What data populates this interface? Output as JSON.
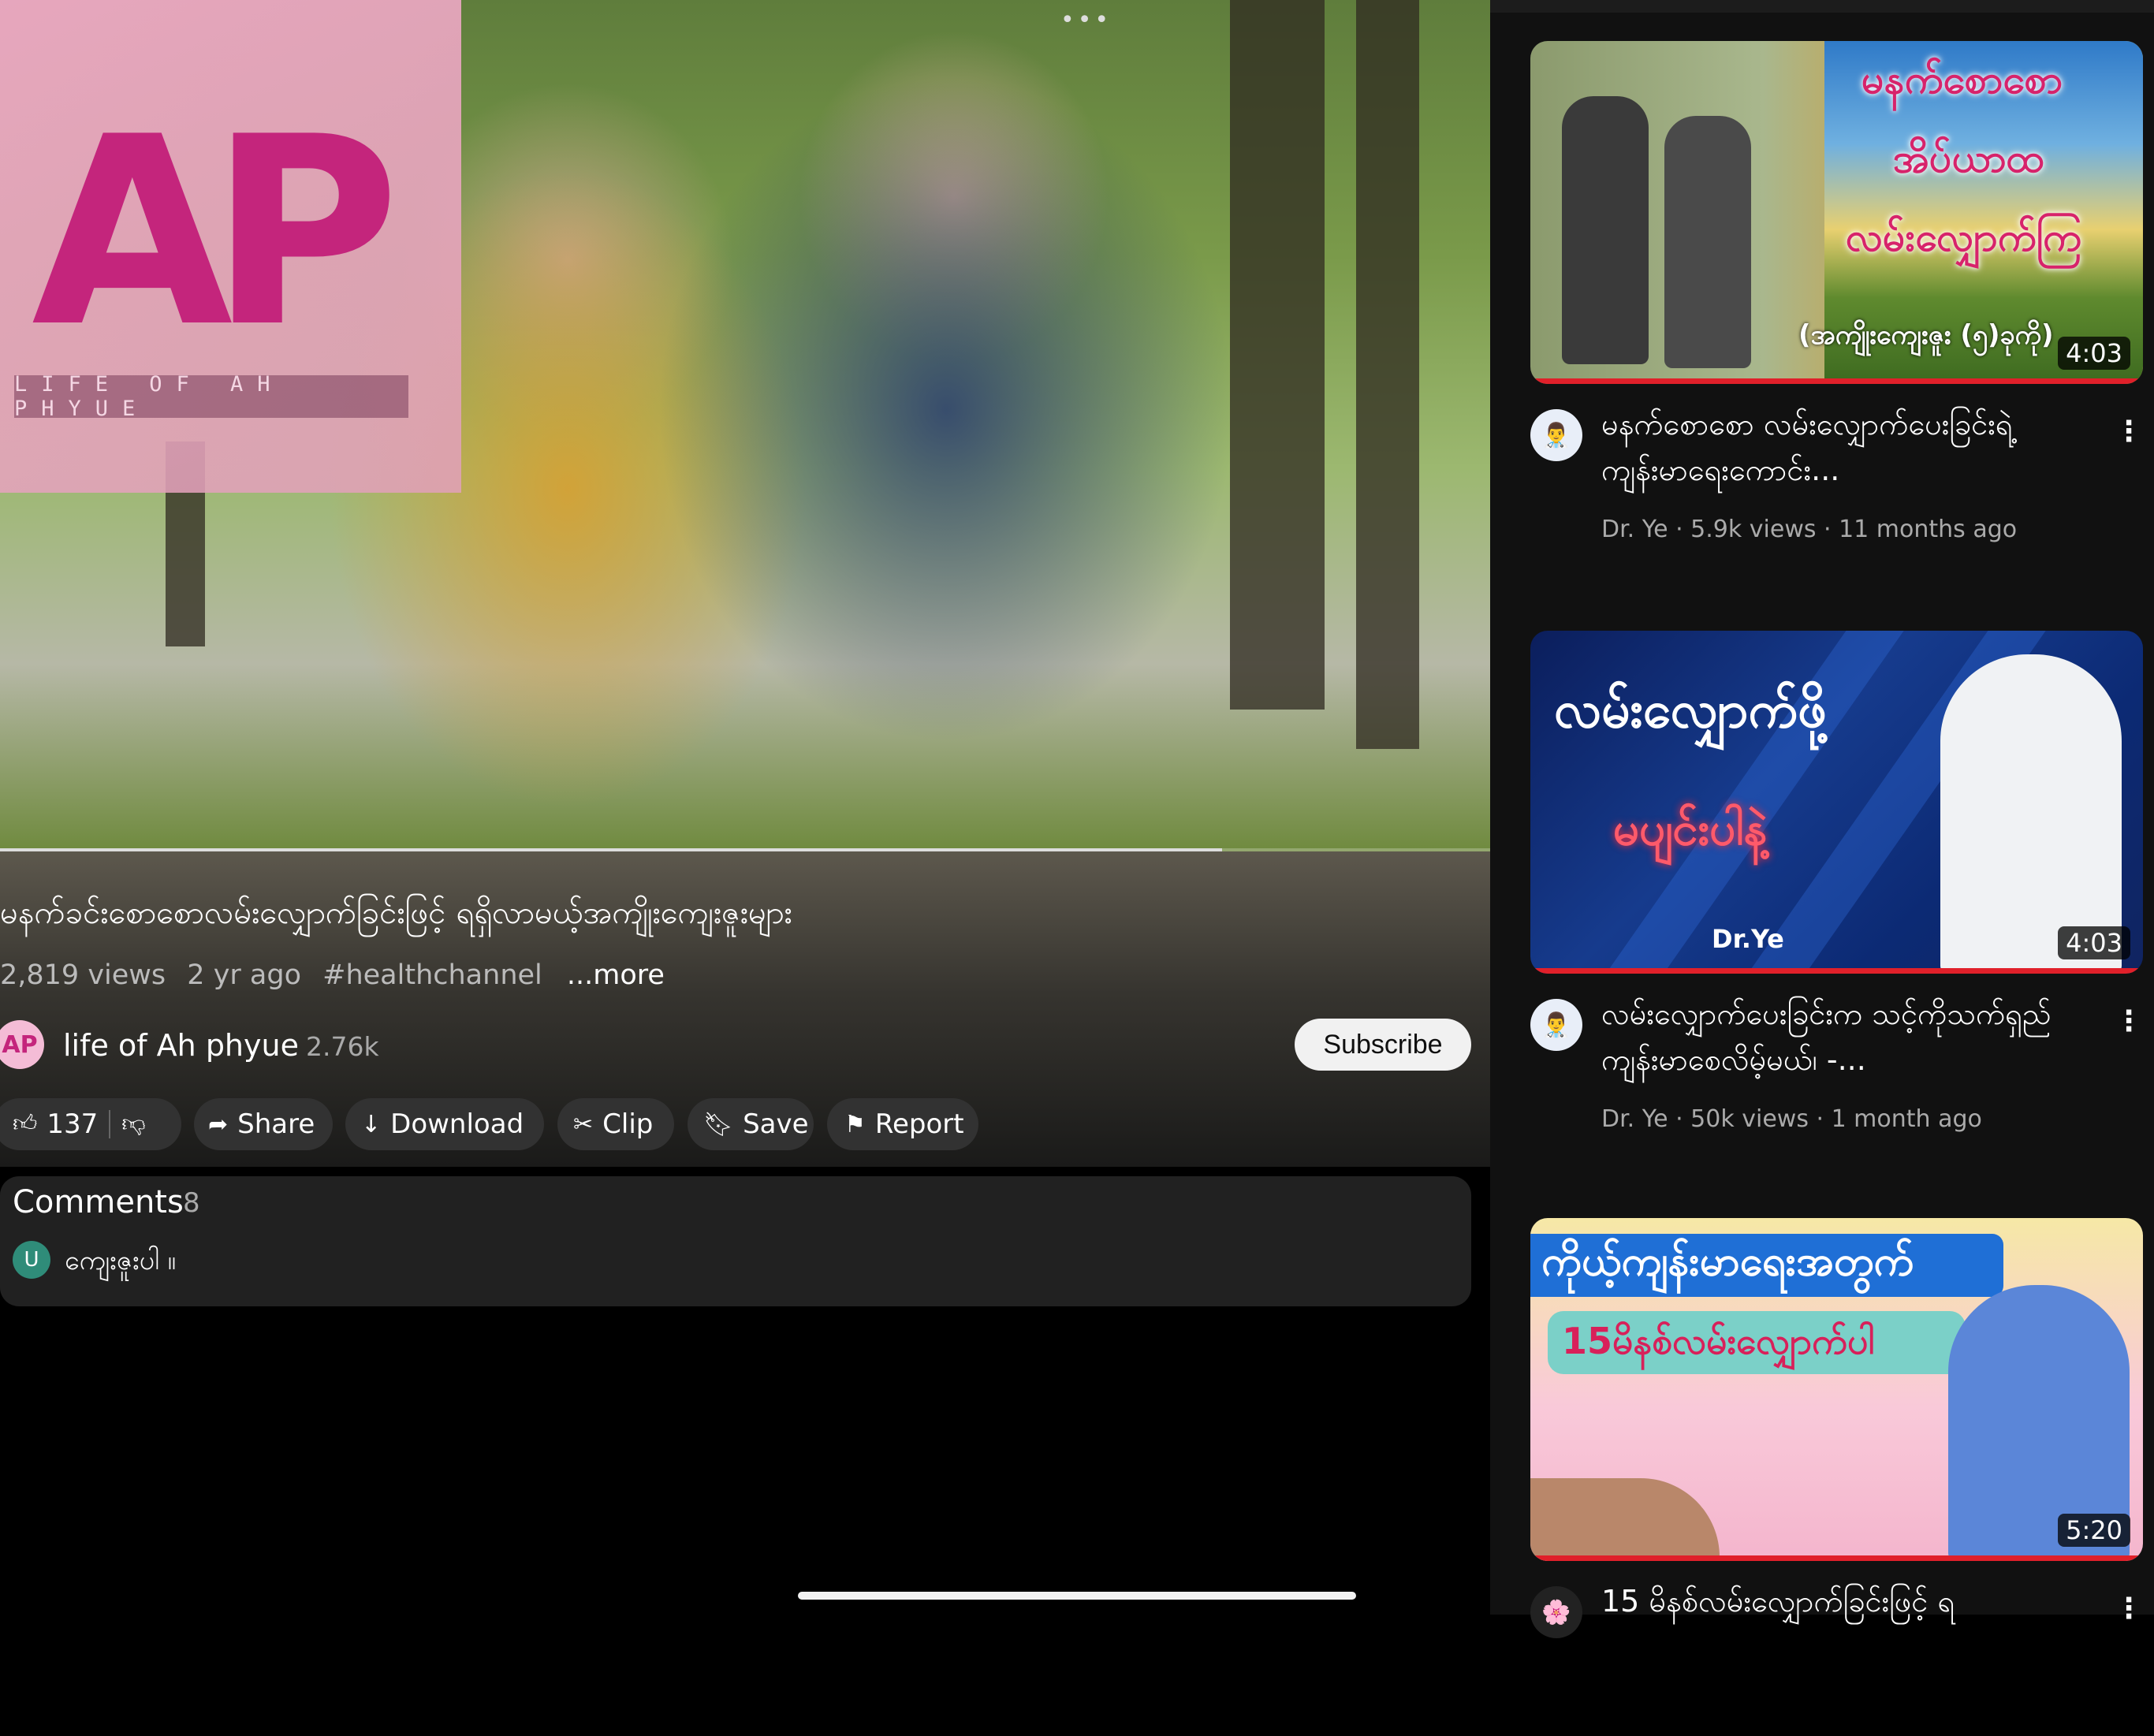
{
  "player": {
    "overlay_logo": "AP",
    "overlay_tagline": "LIFE OF AH PHYUE",
    "more_dots": "•••",
    "progress_fraction": 0.82
  },
  "video": {
    "title": "မနက်ခင်းစောစောလမ်းလျှောက်ခြင်းဖြင့် ရရှိလာမယ့်အကျိုးကျေးဇူးများ",
    "views": "2,819 views",
    "age": "2 yr ago",
    "hashtag": "#healthchannel",
    "more": "...more"
  },
  "channel": {
    "avatar_text": "AP",
    "name": "life of Ah phyue",
    "subscribers": "2.76k",
    "subscribe_label": "Subscribe"
  },
  "actions": {
    "like_count": "137",
    "share": "Share",
    "download": "Download",
    "clip": "Clip",
    "save": "Save",
    "report": "Report"
  },
  "comments": {
    "title": "Comments",
    "count": "8",
    "first_avatar": "U",
    "first_text": "ကျေးဇူးပါ ။"
  },
  "suggestions": [
    {
      "thumb_lines": [
        "မနက်စောစော",
        "အိပ်ယာထ",
        "လမ်းလျှောက်ကြ"
      ],
      "thumb_footer": "(အကျိုးကျေးဇူး (၅)ခုကို)",
      "duration": "4:03",
      "title": "မနက်စောစော လမ်းလျှောက်ပေးခြင်းရဲ့ ကျန်းမာရေးကောင်း...",
      "meta": "Dr. Ye · 5.9k views · 11 months ago"
    },
    {
      "thumb_lines": [
        "လမ်းလျှောက်ဖို့",
        "မပျင်းပါနဲ့"
      ],
      "thumb_footer": "Dr.Ye",
      "duration": "4:03",
      "title": "လမ်းလျှောက်ပေးခြင်းက သင့်ကိုသက်ရှည်ကျန်းမာစေလိမ့်မယ်၊ -...",
      "meta": "Dr. Ye · 50k views · 1 month ago"
    },
    {
      "thumb_lines": [
        "ကိုယ့်ကျန်းမာရေးအတွက်",
        "15မိနစ်လမ်းလျှောက်ပါ"
      ],
      "duration": "5:20",
      "title": "15 မိနစ်လမ်းလျှောက်ခြင်းဖြင့် ရ"
    }
  ],
  "colors": {
    "accent_red": "#e0202a",
    "logo_magenta": "#c4257c",
    "pill_bg": "#323232",
    "comment_bg": "#212121"
  },
  "icons": {
    "like": "thumbs-up-icon",
    "dislike": "thumbs-down-icon",
    "share": "share-arrow-icon",
    "download": "download-arrow-icon",
    "clip": "scissors-icon",
    "save": "bookmark-icon",
    "report": "flag-icon",
    "menu": "vertical-dots-icon"
  }
}
